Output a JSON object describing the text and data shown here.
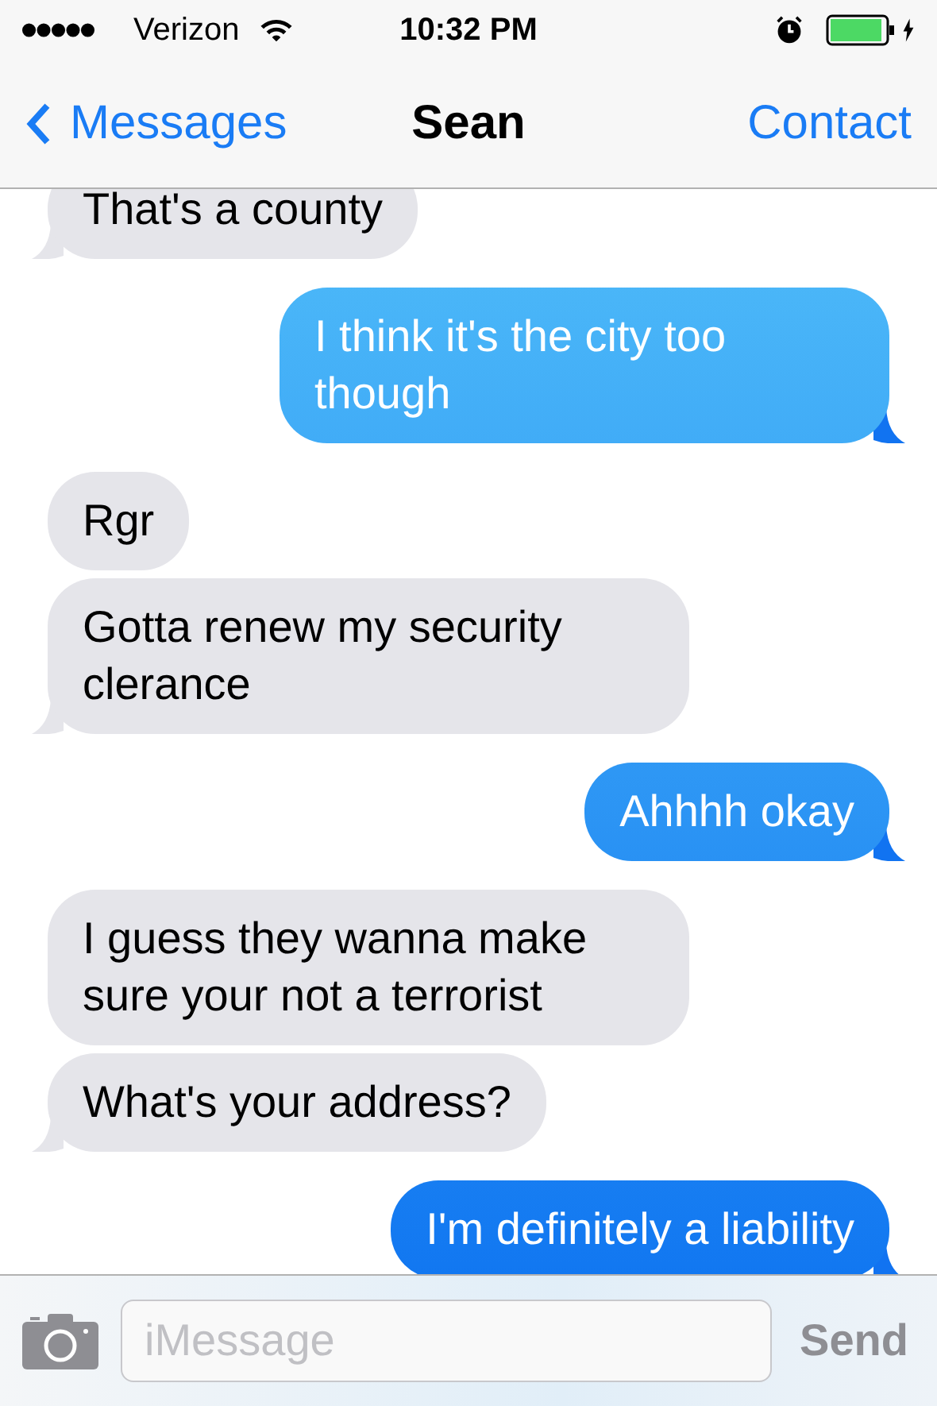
{
  "status_bar": {
    "carrier": "Verizon",
    "time": "10:32 PM"
  },
  "nav": {
    "back": "Messages",
    "title": "Sean",
    "action": "Contact"
  },
  "messages": [
    {
      "text": "That's a county",
      "outgoing": false
    },
    {
      "text": "I think it's the city too though",
      "outgoing": true
    },
    {
      "text": "Rgr",
      "outgoing": false
    },
    {
      "text": "Gotta renew my security clerance",
      "outgoing": false
    },
    {
      "text": "Ahhhh okay",
      "outgoing": true
    },
    {
      "text": "I guess they wanna make sure your not a terrorist",
      "outgoing": false
    },
    {
      "text": "What's your address?",
      "outgoing": false
    },
    {
      "text": "I'm definitely a liability",
      "outgoing": true
    }
  ],
  "composer": {
    "placeholder": "iMessage",
    "send": "Send"
  }
}
